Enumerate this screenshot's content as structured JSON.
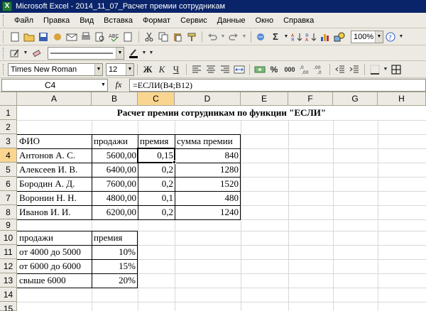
{
  "window": {
    "title": "Microsoft Excel - 2014_11_07_Расчет премии сотрудникам"
  },
  "menu": [
    "Файл",
    "Правка",
    "Вид",
    "Вставка",
    "Формат",
    "Сервис",
    "Данные",
    "Окно",
    "Справка"
  ],
  "toolbar": {
    "zoom": "100%"
  },
  "format": {
    "font": "Times New Roman",
    "size": "12",
    "bold": "Ж",
    "italic": "К",
    "underline": "Ч",
    "percent": "%",
    "thousands": "000"
  },
  "formula_bar": {
    "cell_ref": "C4",
    "fx": "fx",
    "formula": "=ЕСЛИ(B4;B12)"
  },
  "columns": [
    "A",
    "B",
    "C",
    "D",
    "E",
    "F",
    "G",
    "H"
  ],
  "rows": [
    "1",
    "2",
    "3",
    "4",
    "5",
    "6",
    "7",
    "8",
    "9",
    "10",
    "11",
    "12",
    "13",
    "14",
    "15"
  ],
  "cells": {
    "title": "Расчет премии сотрудникам по функции \"ЕСЛИ\"",
    "hdr_fio": "ФИО",
    "hdr_sales": "продажи",
    "hdr_bonus": "премия",
    "hdr_sum": "сумма премии",
    "r4a": "Антонов А. С.",
    "r4b": "5600,00",
    "r4c": "0,15",
    "r4d": "840",
    "r5a": "Алексеев И. В.",
    "r5b": "6400,00",
    "r5c": "0,2",
    "r5d": "1280",
    "r6a": "Бородин А. Д.",
    "r6b": "7600,00",
    "r6c": "0,2",
    "r6d": "1520",
    "r7a": "Воронин Н. Н.",
    "r7b": "4800,00",
    "r7c": "0,1",
    "r7d": "480",
    "r8a": "Иванов И. И.",
    "r8b": "6200,00",
    "r8c": "0,2",
    "r8d": "1240",
    "t10a": "продажи",
    "t10b": "премия",
    "t11a": "от 4000 до 5000",
    "t11b": "10%",
    "t12a": "от 6000 до 6000",
    "t12b": "15%",
    "t13a": "свыше 6000",
    "t13b": "20%"
  }
}
